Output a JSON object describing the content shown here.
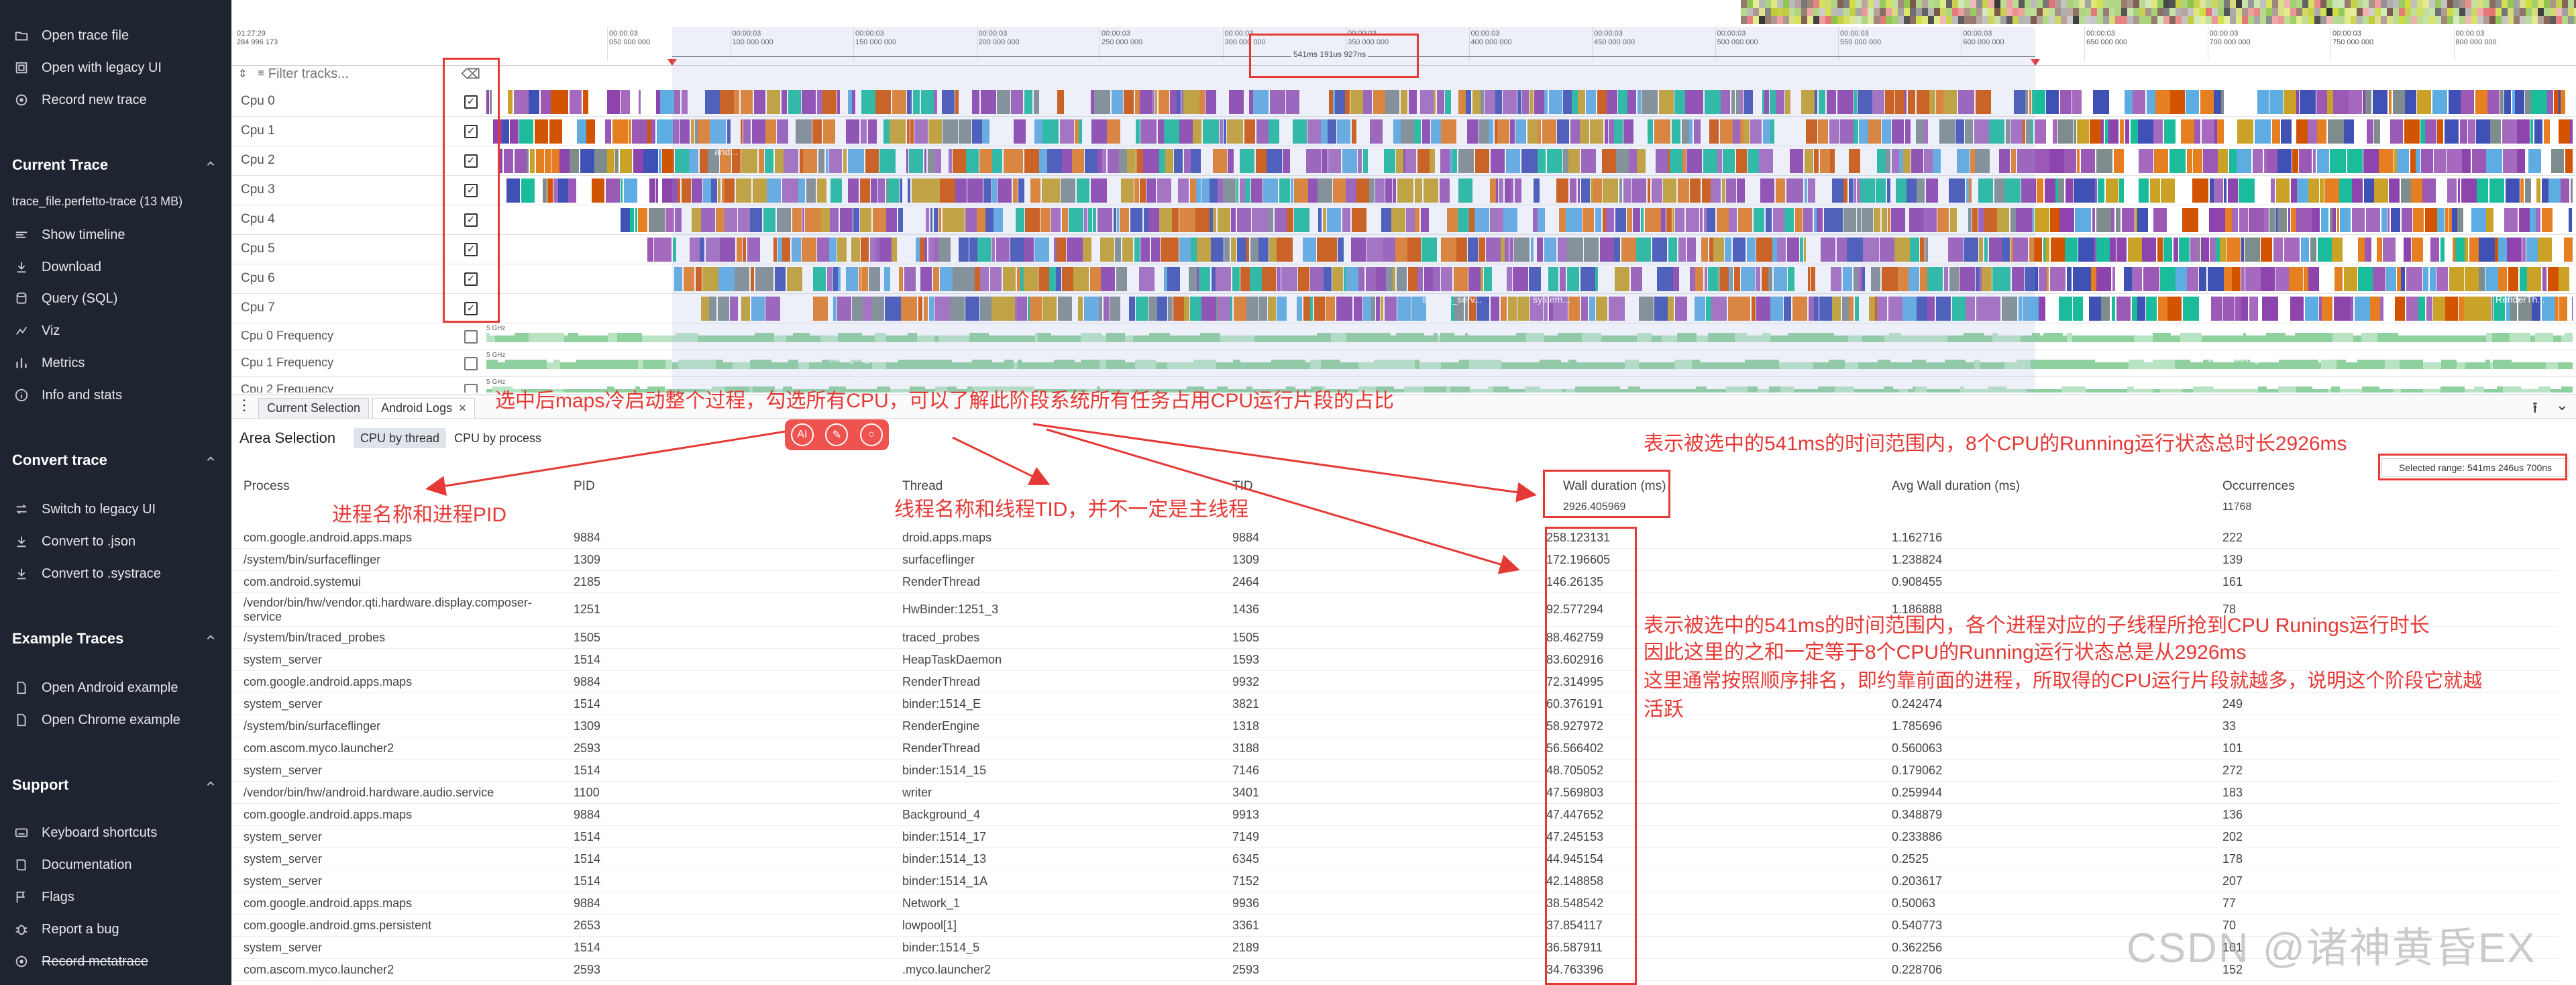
{
  "sidebar": {
    "top_items": [
      {
        "label": "Open trace file",
        "icon": "folder-open-icon"
      },
      {
        "label": "Open with legacy UI",
        "icon": "legacy-window-icon"
      },
      {
        "label": "Record new trace",
        "icon": "record-icon"
      }
    ],
    "sections": [
      {
        "title": "Current Trace",
        "file": "trace_file.perfetto-trace (13 MB)",
        "items": [
          {
            "label": "Show timeline",
            "icon": "timeline-icon"
          },
          {
            "label": "Download",
            "icon": "download-icon"
          },
          {
            "label": "Query (SQL)",
            "icon": "database-icon"
          },
          {
            "label": "Viz",
            "icon": "viz-icon"
          },
          {
            "label": "Metrics",
            "icon": "metrics-icon"
          },
          {
            "label": "Info and stats",
            "icon": "info-icon"
          }
        ]
      },
      {
        "title": "Convert trace",
        "items": [
          {
            "label": "Switch to legacy UI",
            "icon": "switch-icon"
          },
          {
            "label": "Convert to .json",
            "icon": "download-icon"
          },
          {
            "label": "Convert to .systrace",
            "icon": "download-icon"
          }
        ]
      },
      {
        "title": "Example Traces",
        "items": [
          {
            "label": "Open Android example",
            "icon": "file-icon"
          },
          {
            "label": "Open Chrome example",
            "icon": "file-icon"
          }
        ]
      },
      {
        "title": "Support",
        "items": [
          {
            "label": "Keyboard shortcuts",
            "icon": "keyboard-icon"
          },
          {
            "label": "Documentation",
            "icon": "book-icon"
          },
          {
            "label": "Flags",
            "icon": "flag-icon"
          },
          {
            "label": "Report a bug",
            "icon": "bug-icon"
          },
          {
            "label": "Record metatrace",
            "icon": "record-icon"
          }
        ]
      }
    ]
  },
  "timeline": {
    "start_time": "01:27:29",
    "start_ns": "284 996 173",
    "filter_placeholder": "Filter tracks...",
    "ticks": [
      {
        "t": "00:00:03",
        "v": "050 000 000"
      },
      {
        "t": "00:00:03",
        "v": "100 000 000"
      },
      {
        "t": "00:00:03",
        "v": "150 000 000"
      },
      {
        "t": "00:00:03",
        "v": "200 000 000"
      },
      {
        "t": "00:00:03",
        "v": "250 000 000"
      },
      {
        "t": "00:00:03",
        "v": "300 000 000"
      },
      {
        "t": "00:00:03",
        "v": "350 000 000"
      },
      {
        "t": "00:00:03",
        "v": "400 000 000"
      },
      {
        "t": "00:00:03",
        "v": "450 000 000"
      },
      {
        "t": "00:00:03",
        "v": "500 000 000"
      },
      {
        "t": "00:00:03",
        "v": "550 000 000"
      },
      {
        "t": "00:00:03",
        "v": "600 000 000"
      },
      {
        "t": "00:00:03",
        "v": "650 000 000"
      },
      {
        "t": "00:00:03",
        "v": "700 000 000"
      },
      {
        "t": "00:00:03",
        "v": "750 000 000"
      },
      {
        "t": "00:00:03",
        "v": "800 000 000"
      }
    ],
    "selection_label": "541ms 191us 927ns",
    "tracks": [
      {
        "name": "Cpu 0",
        "checked": true
      },
      {
        "name": "Cpu 1",
        "checked": true
      },
      {
        "name": "Cpu 2",
        "checked": true
      },
      {
        "name": "Cpu 3",
        "checked": true
      },
      {
        "name": "Cpu 4",
        "checked": true
      },
      {
        "name": "Cpu 5",
        "checked": true
      },
      {
        "name": "Cpu 6",
        "checked": true
      },
      {
        "name": "Cpu 7",
        "checked": true
      }
    ],
    "freq_tracks": [
      {
        "name": "Cpu 0 Frequency",
        "scale": "5 GHz"
      },
      {
        "name": "Cpu 1 Frequency",
        "scale": "5 GHz"
      },
      {
        "name": "Cpu 2 Frequency",
        "scale": "5 GHz"
      }
    ],
    "slice_labels": [
      "and...",
      "system_serv...",
      "system...",
      "com.google...",
      "droid.apps...",
      "co...",
      "com.goo...",
      "RenderTh..."
    ]
  },
  "panel": {
    "tabs": [
      "Current Selection",
      "Android Logs"
    ],
    "area_title": "Area Selection",
    "modes": [
      "CPU by thread",
      "CPU by process"
    ],
    "selected_range": "Selected range: 541ms 246us 700ns",
    "columns": [
      "Process",
      "PID",
      "Thread",
      "TID",
      "Wall duration (ms)",
      "Avg Wall duration (ms)",
      "Occurrences"
    ],
    "summary": {
      "wall": "2926.405969",
      "occ": "11768"
    },
    "rows": [
      [
        "com.google.android.apps.maps",
        "9884",
        "droid.apps.maps",
        "9884",
        "258.123131",
        "1.162716",
        "222"
      ],
      [
        "/system/bin/surfaceflinger",
        "1309",
        "surfaceflinger",
        "1309",
        "172.196605",
        "1.238824",
        "139"
      ],
      [
        "com.android.systemui",
        "2185",
        "RenderThread",
        "2464",
        "146.26135",
        "0.908455",
        "161"
      ],
      [
        "/vendor/bin/hw/vendor.qti.hardware.display.composer-service",
        "1251",
        "HwBinder:1251_3",
        "1436",
        "92.577294",
        "1.186888",
        "78"
      ],
      [
        "/system/bin/traced_probes",
        "1505",
        "traced_probes",
        "1505",
        "88.462759",
        "",
        ""
      ],
      [
        "system_server",
        "1514",
        "HeapTaskDaemon",
        "1593",
        "83.602916",
        "",
        ""
      ],
      [
        "com.google.android.apps.maps",
        "9884",
        "RenderThread",
        "9932",
        "72.314995",
        "",
        ""
      ],
      [
        "system_server",
        "1514",
        "binder:1514_E",
        "3821",
        "60.376191",
        "0.242474",
        "249"
      ],
      [
        "/system/bin/surfaceflinger",
        "1309",
        "RenderEngine",
        "1318",
        "58.927972",
        "1.785696",
        "33"
      ],
      [
        "com.ascom.myco.launcher2",
        "2593",
        "RenderThread",
        "3188",
        "56.566402",
        "0.560063",
        "101"
      ],
      [
        "system_server",
        "1514",
        "binder:1514_15",
        "7146",
        "48.705052",
        "0.179062",
        "272"
      ],
      [
        "/vendor/bin/hw/android.hardware.audio.service",
        "1100",
        "writer",
        "3401",
        "47.569803",
        "0.259944",
        "183"
      ],
      [
        "com.google.android.apps.maps",
        "9884",
        "Background_4",
        "9913",
        "47.447652",
        "0.348879",
        "136"
      ],
      [
        "system_server",
        "1514",
        "binder:1514_17",
        "7149",
        "47.245153",
        "0.233886",
        "202"
      ],
      [
        "system_server",
        "1514",
        "binder:1514_13",
        "6345",
        "44.945154",
        "0.2525",
        "178"
      ],
      [
        "system_server",
        "1514",
        "binder:1514_1A",
        "7152",
        "42.148858",
        "0.203617",
        "207"
      ],
      [
        "com.google.android.apps.maps",
        "9884",
        "Network_1",
        "9936",
        "38.548542",
        "0.50063",
        "77"
      ],
      [
        "com.google.android.gms.persistent",
        "2653",
        "lowpool[1]",
        "3361",
        "37.854117",
        "0.540773",
        "70"
      ],
      [
        "system_server",
        "1514",
        "binder:1514_5",
        "2189",
        "36.587911",
        "0.362256",
        "101"
      ],
      [
        "com.ascom.myco.launcher2",
        "2593",
        ".myco.launcher2",
        "2593",
        "34.763396",
        "0.228706",
        "152"
      ]
    ]
  },
  "annotations": {
    "top": "选中后maps冷启动整个过程，勾选所有CPU，可以了解此阶段系统所有任务占用CPU运行片段的占比",
    "total": "表示被选中的541ms的时间范围内，8个CPU的Running运行状态总时长2926ms",
    "process": "进程名称和进程PID",
    "thread": "线程名称和线程TID，并不一定是主线程",
    "explain_lines": [
      "表示被选中的541ms的时间范围内，各个进程对应的子线程所抢到CPU Runings运行时长",
      "因此这里的之和一定等于8个CPU的Running运行状态总是从2926ms",
      "这里通常按照顺序排名，即约靠前面的进程，所取得的CPU运行片段就越多，说明这个阶段它就越",
      "活跃"
    ],
    "watermark": "CSDN @诸神黄昏EX",
    "color": "#e53935"
  }
}
